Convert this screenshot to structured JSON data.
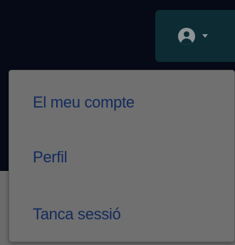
{
  "user_menu": {
    "toggle_icon": "user-circle-icon",
    "caret_icon": "caret-down-icon",
    "items": [
      {
        "label": "El meu compte"
      },
      {
        "label": "Perfil"
      },
      {
        "label": "Tanca sessió"
      }
    ]
  },
  "colors": {
    "navbar": "#060916",
    "toggle_background": "#0c2b33",
    "dropdown_background": "#707070",
    "menu_text": "#132a5c"
  }
}
